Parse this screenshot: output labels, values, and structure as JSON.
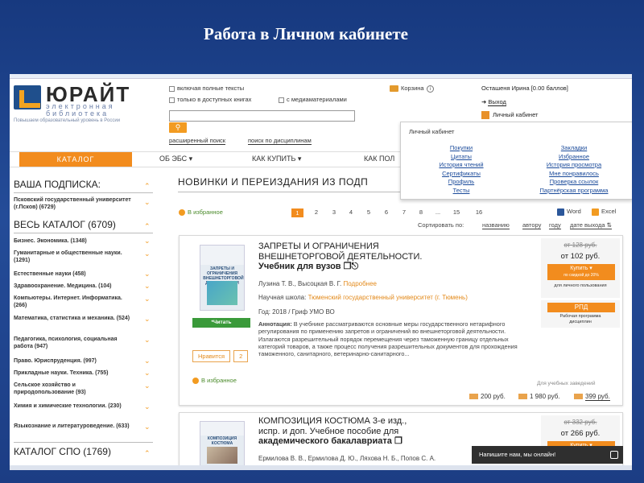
{
  "slide": {
    "title": "Работа в Личном кабинете"
  },
  "header": {
    "logo_name": "ЮРАЙТ",
    "logo_sub_1": "электронная",
    "logo_sub_2": "библиотека",
    "tagline": "Повышаем образовательный уровень в России",
    "opt_full_text": "включая полные тексты",
    "opt_available": "только в доступных книгах",
    "opt_media": "с медиаматериалами",
    "search_placeholder": "",
    "search_icon": "search-icon",
    "advanced_search": "расширенный поиск",
    "discipline_search": "поиск по дисциплинам",
    "cart": "Корзина",
    "user": "Осташеня Ирина [0.00 баллов]",
    "logout": "Выход",
    "cabinet": "Личный кабинет"
  },
  "dropdown": {
    "title": "Личный кабинет",
    "left": [
      "Покупки",
      "Цитаты",
      "История чтений",
      "Сертификаты",
      "Профиль",
      "Тесты"
    ],
    "right": [
      "Закладки",
      "Избранное",
      "История просмотра",
      "Мне понравилось",
      "Проверка ссылок",
      "Партнёрская программа"
    ]
  },
  "nav": {
    "catalog": "КАТАЛОГ",
    "ebs": "ОБ ЭБС ▾",
    "buy": "КАК КУПИТЬ ▾",
    "more": "КАК ПОЛ"
  },
  "sidebar": {
    "subscription": "ВАША ПОДПИСКА:",
    "subscription_item": "Псковский государственный университет (г.Псков) (6729)",
    "full_catalog": "ВЕСЬ КАТАЛОГ (6709)",
    "items": [
      "Бизнес. Экономика. (1348)",
      "Гуманитарные и общественные науки. (1291)",
      "Естественные науки (458)",
      "Здравоохранение. Медицина. (104)",
      "Компьютеры. Интернет. Информатика. (266)",
      "Математика, статистика и механика. (524)",
      "Педагогика, психология, социальная работа (947)",
      "Право. Юриспруденция. (997)",
      "Прикладные науки. Техника. (755)",
      "Сельское хозяйство и природопользование (93)",
      "Химия и химические технологии. (230)",
      "Языкознание и литературоведение. (633)"
    ],
    "spo": "КАТАЛОГ СПО (1769)"
  },
  "main": {
    "heading": "НОВИНКИ И ПЕРЕИЗДАНИЯ ИЗ ПОДП",
    "to_favorites": "В избранное",
    "pages": [
      "1",
      "2",
      "3",
      "4",
      "5",
      "6",
      "7",
      "8",
      "...",
      "15",
      "16"
    ],
    "word": "Word",
    "excel": "Excel",
    "sort_label": "Сортировать по:",
    "sort_options": [
      "названию",
      "автору",
      "году",
      "дате выхода ⇅"
    ]
  },
  "books": [
    {
      "cover_title": "ЗАПРЕТЫ И ОГРАНИЧЕНИЯ ВНЕШНЕТОРГОВОЙ ДЕЯТЕЛЬНОСТИ",
      "read": "Читать",
      "title_1": "ЗАПРЕТЫ И ОГРАНИЧЕНИЯ",
      "title_2": "ВНЕШНЕТОРГОВОЙ ДЕЯТЕЛЬНОСТИ.",
      "subtitle": "Учебник для вузов",
      "authors": "Лузина Т. В., Высоцкая В. Г.",
      "more": "Подробнее",
      "school_label": "Научная школа:",
      "school": "Тюменский государственный университет (г. Тюмень)",
      "year": "Год: 2018 / Гриф УМО ВО",
      "annotation_label": "Аннотация:",
      "annotation": "В учебнике рассматриваются основные меры государственного нетарифного регулирования по применению запретов и ограничений во внешнеторговой деятельности. Излагаются разрешительный порядок перемещения через таможенную границу отдельных категорий товаров, а также процесс получения разрешительных документов для прохождения таможенного, санитарного, ветеринарно-санитарного...",
      "like": "Нравится",
      "like_count": "2",
      "to_favorites": "В избранное",
      "old_price": "от 128 руб.",
      "new_price": "от 102 руб.",
      "buy": "Купить ▾",
      "discount": "по скидкой до 20%",
      "personal": "для личного пользования",
      "rpd": "РПД",
      "rpd_note_1": "Рабочая программа",
      "rpd_note_2": "дисциплин",
      "univ": "Для учебных заведений",
      "price_1": "200 руб.",
      "price_2": "1 980 руб.",
      "price_3": "399 руб."
    },
    {
      "cover_title": "КОМПОЗИЦИЯ КОСТЮМА",
      "title_1": "КОМПОЗИЦИЯ КОСТЮМА 3-е изд.,",
      "title_2": "испр. и доп. Учебное пособие для",
      "subtitle": "академического бакалавриата",
      "authors": "Ермилова В. В., Ермилова Д. Ю., Ляхова Н. Б., Попов С. А.",
      "old_price": "от 332 руб.",
      "new_price": "от 266 руб.",
      "buy": "Купить ▾"
    }
  ],
  "chat": {
    "label": "Напишите нам, мы онлайн!"
  }
}
